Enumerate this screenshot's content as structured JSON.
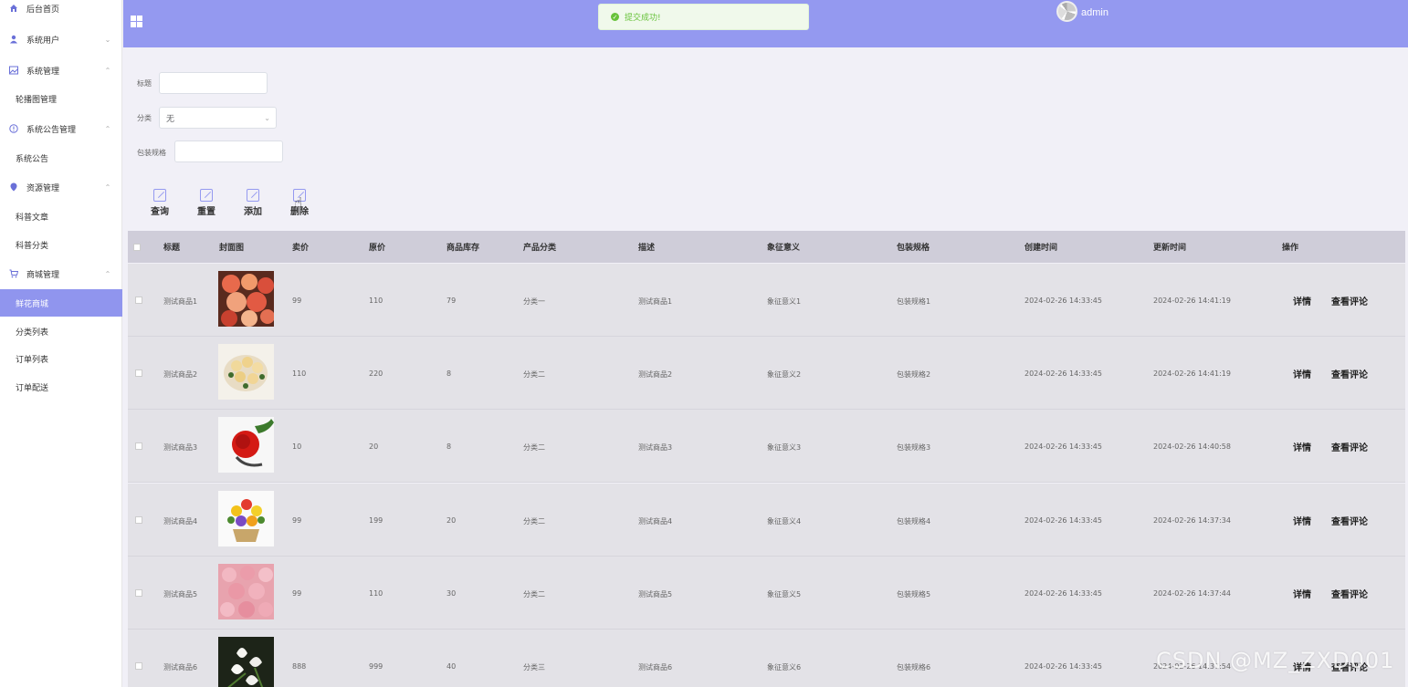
{
  "sidebar": {
    "items": [
      {
        "label": "后台首页",
        "icon": "home-icon"
      },
      {
        "label": "系统用户",
        "icon": "user-icon"
      },
      {
        "label": "系统管理",
        "icon": "picture-icon"
      },
      {
        "label": "轮播图管理"
      },
      {
        "label": "系统公告管理",
        "icon": "info-icon"
      },
      {
        "label": "系统公告"
      },
      {
        "label": "资源管理",
        "icon": "location-icon"
      },
      {
        "label": "科普文章"
      },
      {
        "label": "科普分类"
      },
      {
        "label": "商城管理",
        "icon": "cart-icon"
      },
      {
        "label": "鲜花商城"
      },
      {
        "label": "分类列表"
      },
      {
        "label": "订单列表"
      },
      {
        "label": "订单配送"
      }
    ]
  },
  "header": {
    "toast": "提交成功!",
    "username": "admin",
    "accent": "#9499f0"
  },
  "search": {
    "title_label": "标题",
    "title_value": "",
    "category_label": "分类",
    "category_value": "无",
    "spec_label": "包装规格",
    "spec_value": ""
  },
  "actions": {
    "query": "查询",
    "reset": "重置",
    "add": "添加",
    "delete": "删除"
  },
  "table": {
    "columns": [
      "标题",
      "封面图",
      "卖价",
      "原价",
      "商品库存",
      "产品分类",
      "描述",
      "象征意义",
      "包装规格",
      "创建时间",
      "更新时间",
      "操作"
    ],
    "rows": [
      {
        "title": "测试商品1",
        "price": "99",
        "original": "110",
        "stock": "79",
        "category": "分类一",
        "desc": "测试商品1",
        "meaning": "象征意义1",
        "spec": "包装规格1",
        "created": "2024-02-26 14:33:45",
        "updated": "2024-02-26 14:41:19",
        "op1": "详情",
        "op2": "查看评论"
      },
      {
        "title": "测试商品2",
        "price": "110",
        "original": "220",
        "stock": "8",
        "category": "分类二",
        "desc": "测试商品2",
        "meaning": "象征意义2",
        "spec": "包装规格2",
        "created": "2024-02-26 14:33:45",
        "updated": "2024-02-26 14:41:19",
        "op1": "详情",
        "op2": "查看评论"
      },
      {
        "title": "测试商品3",
        "price": "10",
        "original": "20",
        "stock": "8",
        "category": "分类二",
        "desc": "测试商品3",
        "meaning": "象征意义3",
        "spec": "包装规格3",
        "created": "2024-02-26 14:33:45",
        "updated": "2024-02-26 14:40:58",
        "op1": "详情",
        "op2": "查看评论"
      },
      {
        "title": "测试商品4",
        "price": "99",
        "original": "199",
        "stock": "20",
        "category": "分类二",
        "desc": "测试商品4",
        "meaning": "象征意义4",
        "spec": "包装规格4",
        "created": "2024-02-26 14:33:45",
        "updated": "2024-02-26 14:37:34",
        "op1": "详情",
        "op2": "查看评论"
      },
      {
        "title": "测试商品5",
        "price": "99",
        "original": "110",
        "stock": "30",
        "category": "分类二",
        "desc": "测试商品5",
        "meaning": "象征意义5",
        "spec": "包装规格5",
        "created": "2024-02-26 14:33:45",
        "updated": "2024-02-26 14:37:44",
        "op1": "详情",
        "op2": "查看评论"
      },
      {
        "title": "测试商品6",
        "price": "888",
        "original": "999",
        "stock": "40",
        "category": "分类三",
        "desc": "测试商品6",
        "meaning": "象征意义6",
        "spec": "包装规格6",
        "created": "2024-02-26 14:33:45",
        "updated": "2024-02-26 14:37:54",
        "op1": "详情",
        "op2": "查看评论"
      }
    ]
  },
  "watermark": "CSDN @MZ_ZXD001"
}
